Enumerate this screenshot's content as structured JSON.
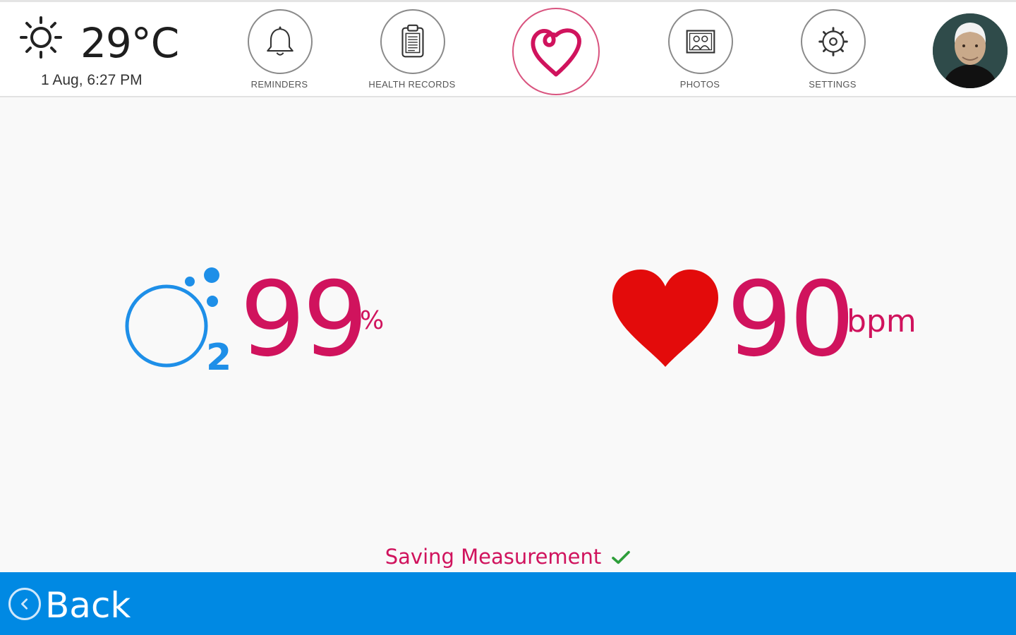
{
  "header": {
    "weather": {
      "icon": "sun-icon",
      "temperature": "29°C",
      "datetime": "1 Aug, 6:27 PM"
    },
    "nav": [
      {
        "id": "reminders",
        "label": "REMINDERS",
        "icon": "bell-icon"
      },
      {
        "id": "health-records",
        "label": "HEALTH RECORDS",
        "icon": "clipboard-icon"
      },
      {
        "id": "home",
        "label": "",
        "icon": "heart-logo-icon"
      },
      {
        "id": "photos",
        "label": "PHOTOS",
        "icon": "photo-frame-icon"
      },
      {
        "id": "settings",
        "label": "SETTINGS",
        "icon": "gear-icon"
      }
    ],
    "avatar": "user-avatar"
  },
  "measurement": {
    "spo2": {
      "icon": "oxygen-o2-icon",
      "value": "99",
      "unit": "%"
    },
    "pulse": {
      "icon": "heart-icon",
      "value": "90",
      "unit": "bpm"
    },
    "status": "Saving Measurement",
    "status_icon": "checkmark-icon"
  },
  "footer": {
    "back_label": "Back",
    "back_icon": "chevron-left-circle-icon"
  },
  "colors": {
    "accent": "#d0135d",
    "oxygen_blue": "#1e8fe8",
    "heart_red": "#e30b0b",
    "bar_blue": "#0089e3",
    "check_green": "#2e9e3a"
  }
}
